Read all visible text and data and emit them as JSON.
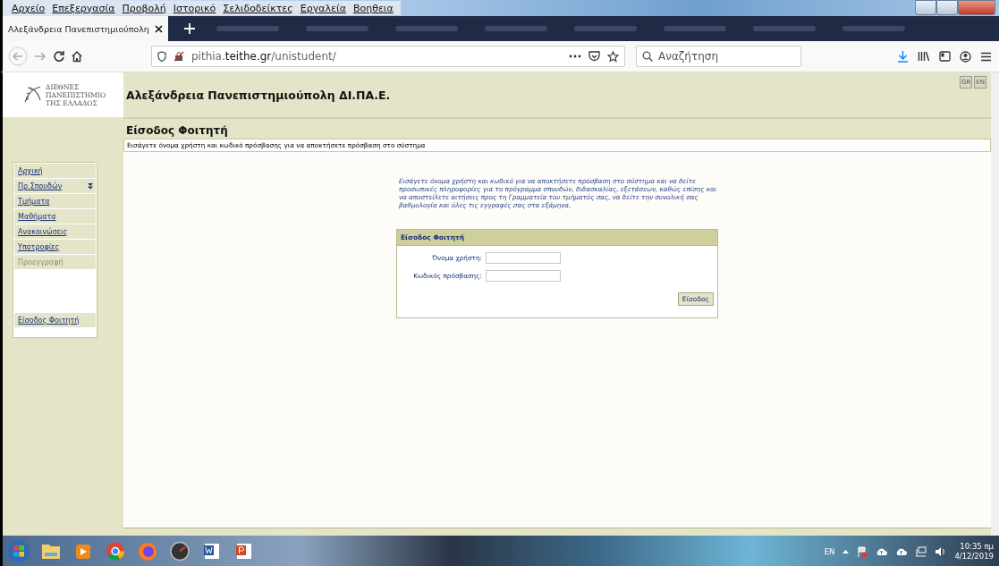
{
  "menu_bar": [
    "Αρχείο",
    "Επεξεργασία",
    "Προβολή",
    "Ιστορικό",
    "Σελιδοδείκτες",
    "Εργαλεία",
    "Βοηθεια"
  ],
  "tabs": [
    {
      "title": "Αλεξάνδρεια Πανεπιστημιούπολη",
      "selected": true
    },
    {
      "selected": false
    },
    {
      "selected": false
    },
    {
      "selected": false
    },
    {
      "selected": false
    },
    {
      "selected": false
    },
    {
      "selected": false
    },
    {
      "selected": false
    },
    {
      "selected": false
    }
  ],
  "address": {
    "host_prefix": "pithia.",
    "host": "teithe.gr",
    "path": "/unistudent/"
  },
  "search": {
    "placeholder": "Αναζήτηση"
  },
  "logo": {
    "lines": [
      "ΔΙΕΘΝΕΣ",
      "ΠΑΝΕΠΙΣΤΗΜΙΟ",
      "ΤΗΣ ΕΛΛΑΔΟΣ"
    ]
  },
  "site_title": "Αλεξάνδρεια Πανεπιστημιούπολη ΔΙ.ΠΑ.Ε.",
  "languages": [
    "GR",
    "EN"
  ],
  "page_title": "Είσοδος Φοιτητή",
  "page_subtitle": "Εισάγετε όνομα χρήστη και κωδικό πρόσβασης για να αποκτήσετε πρόσβαση στο σύστημα",
  "sidebar": {
    "items": [
      {
        "label": "Αρχική",
        "disabled": false,
        "expandable": false
      },
      {
        "label": "Πρ.Σπουδών",
        "disabled": false,
        "expandable": true
      },
      {
        "label": "Τμήματα",
        "disabled": false,
        "expandable": false
      },
      {
        "label": "Μαθήματα",
        "disabled": false,
        "expandable": false
      },
      {
        "label": "Ανακοινώσεις",
        "disabled": false,
        "expandable": false
      },
      {
        "label": "Υποτροφίες",
        "disabled": false,
        "expandable": false
      },
      {
        "label": "Προεγγραφή",
        "disabled": true,
        "expandable": false
      }
    ],
    "login_link": "Είσοδος Φοιτητή"
  },
  "intro": "Εισάγετε όνομα χρήστη και κωδικό για να αποκτήσετε πρόσβαση στο σύστημα και να δείτε προσωπικές πληροφορίες για το πρόγραμμα σπουδών, διδασκαλίας, εξετάσεων, καθώς επίσης και να αποστείλετε αιτήσεις προς τη Γραμματεία του τμήματός σας, να δείτε την συνολική σας βαθμολογία και όλες τις εγγραφές σας στα εξάμηνα.",
  "login_form": {
    "title": "Είσοδος Φοιτητή",
    "fields": [
      {
        "label": "Όνομα χρήστη:"
      },
      {
        "label": "Κωδικός πρόσβασης:"
      }
    ],
    "submit": "Είσοδος"
  },
  "taskbar": {
    "language": "EN",
    "time": "10:35 πμ",
    "date": "4/12/2019"
  }
}
